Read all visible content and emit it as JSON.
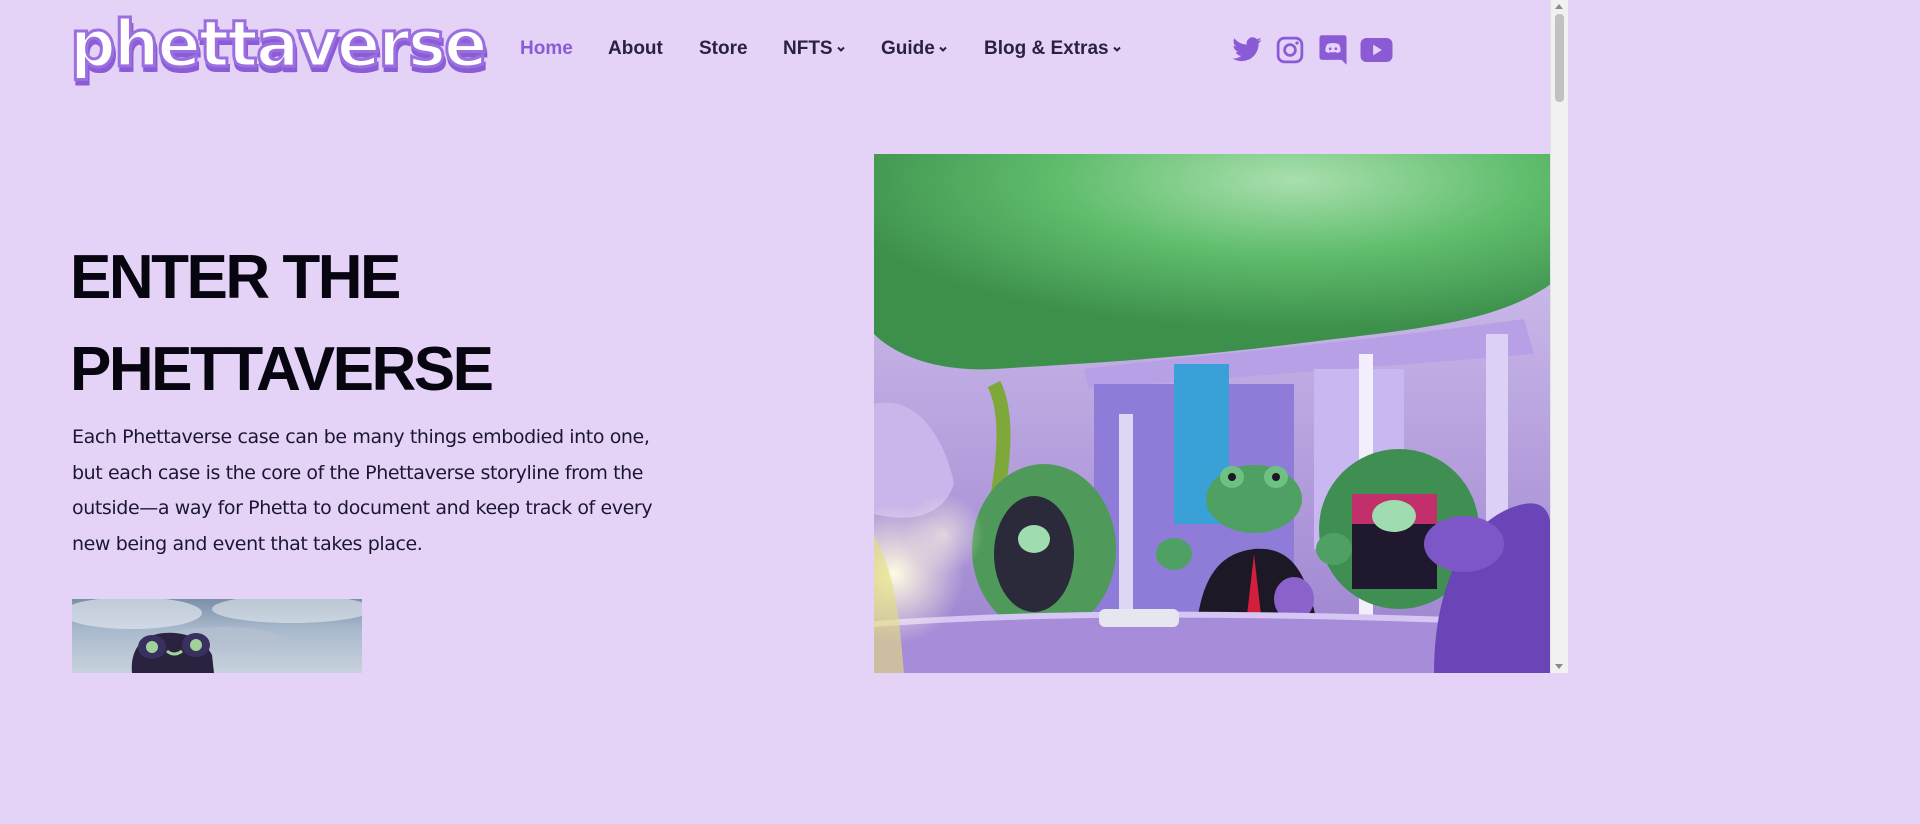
{
  "logo": {
    "text": "phettaverse"
  },
  "nav": {
    "items": [
      {
        "label": "Home",
        "active": true,
        "dropdown": false
      },
      {
        "label": "About",
        "active": false,
        "dropdown": false
      },
      {
        "label": "Store",
        "active": false,
        "dropdown": false
      },
      {
        "label": "NFTS",
        "active": false,
        "dropdown": true
      },
      {
        "label": "Guide",
        "active": false,
        "dropdown": true
      },
      {
        "label": "Blog & Extras",
        "active": false,
        "dropdown": true
      }
    ]
  },
  "social": [
    "twitter-icon",
    "instagram-icon",
    "discord-icon",
    "youtube-icon"
  ],
  "hero": {
    "title_line1": "ENTER THE",
    "title_line2": "PHETTAVERSE",
    "body": "Each Phettaverse case can be many things embodied into one, but each case is the core of the Phettaverse storyline from the outside—a way for Phetta to document and keep track of every new being and event that takes place."
  },
  "colors": {
    "background": "#e4d3f7",
    "accent": "#8b5bd6",
    "nav_text": "#2a1f45",
    "title": "#070510"
  }
}
